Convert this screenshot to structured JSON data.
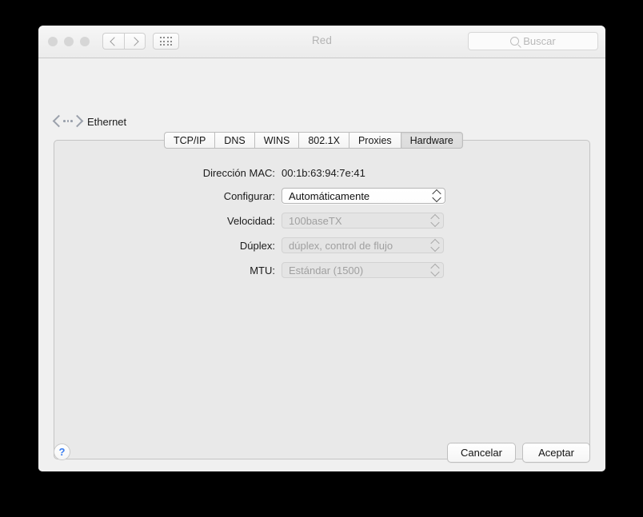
{
  "window": {
    "title": "Red",
    "traffic_lights": [
      "close",
      "minimize",
      "zoom"
    ]
  },
  "toolbar": {
    "back_icon": "chevron-left-icon",
    "forward_icon": "chevron-right-icon",
    "grid_icon": "show-all-grid-icon",
    "search": {
      "icon": "search-icon",
      "placeholder": "Buscar",
      "value": ""
    }
  },
  "service": {
    "icon": "ethernet-icon",
    "name": "Ethernet"
  },
  "tabs": [
    {
      "label": "TCP/IP",
      "selected": false
    },
    {
      "label": "DNS",
      "selected": false
    },
    {
      "label": "WINS",
      "selected": false
    },
    {
      "label": "802.1X",
      "selected": false
    },
    {
      "label": "Proxies",
      "selected": false
    },
    {
      "label": "Hardware",
      "selected": true
    }
  ],
  "form": {
    "mac": {
      "label": "Dirección MAC:",
      "value": "00:1b:63:94:7e:41"
    },
    "configure": {
      "label": "Configurar:",
      "value": "Automáticamente",
      "enabled": true
    },
    "speed": {
      "label": "Velocidad:",
      "value": "100baseTX",
      "enabled": false
    },
    "duplex": {
      "label": "Dúplex:",
      "value": "dúplex, control de flujo",
      "enabled": false
    },
    "mtu": {
      "label": "MTU:",
      "value": "Estándar  (1500)",
      "enabled": false
    }
  },
  "footer": {
    "help_label": "?",
    "cancel_label": "Cancelar",
    "ok_label": "Aceptar"
  },
  "colors": {
    "accent_blue": "#3a7df0",
    "window_bg": "#f0f0f0",
    "panel_bg": "#e9e9e9",
    "titlebar_bg": "#f1f1f1",
    "disabled_text": "#a0a0a0"
  }
}
